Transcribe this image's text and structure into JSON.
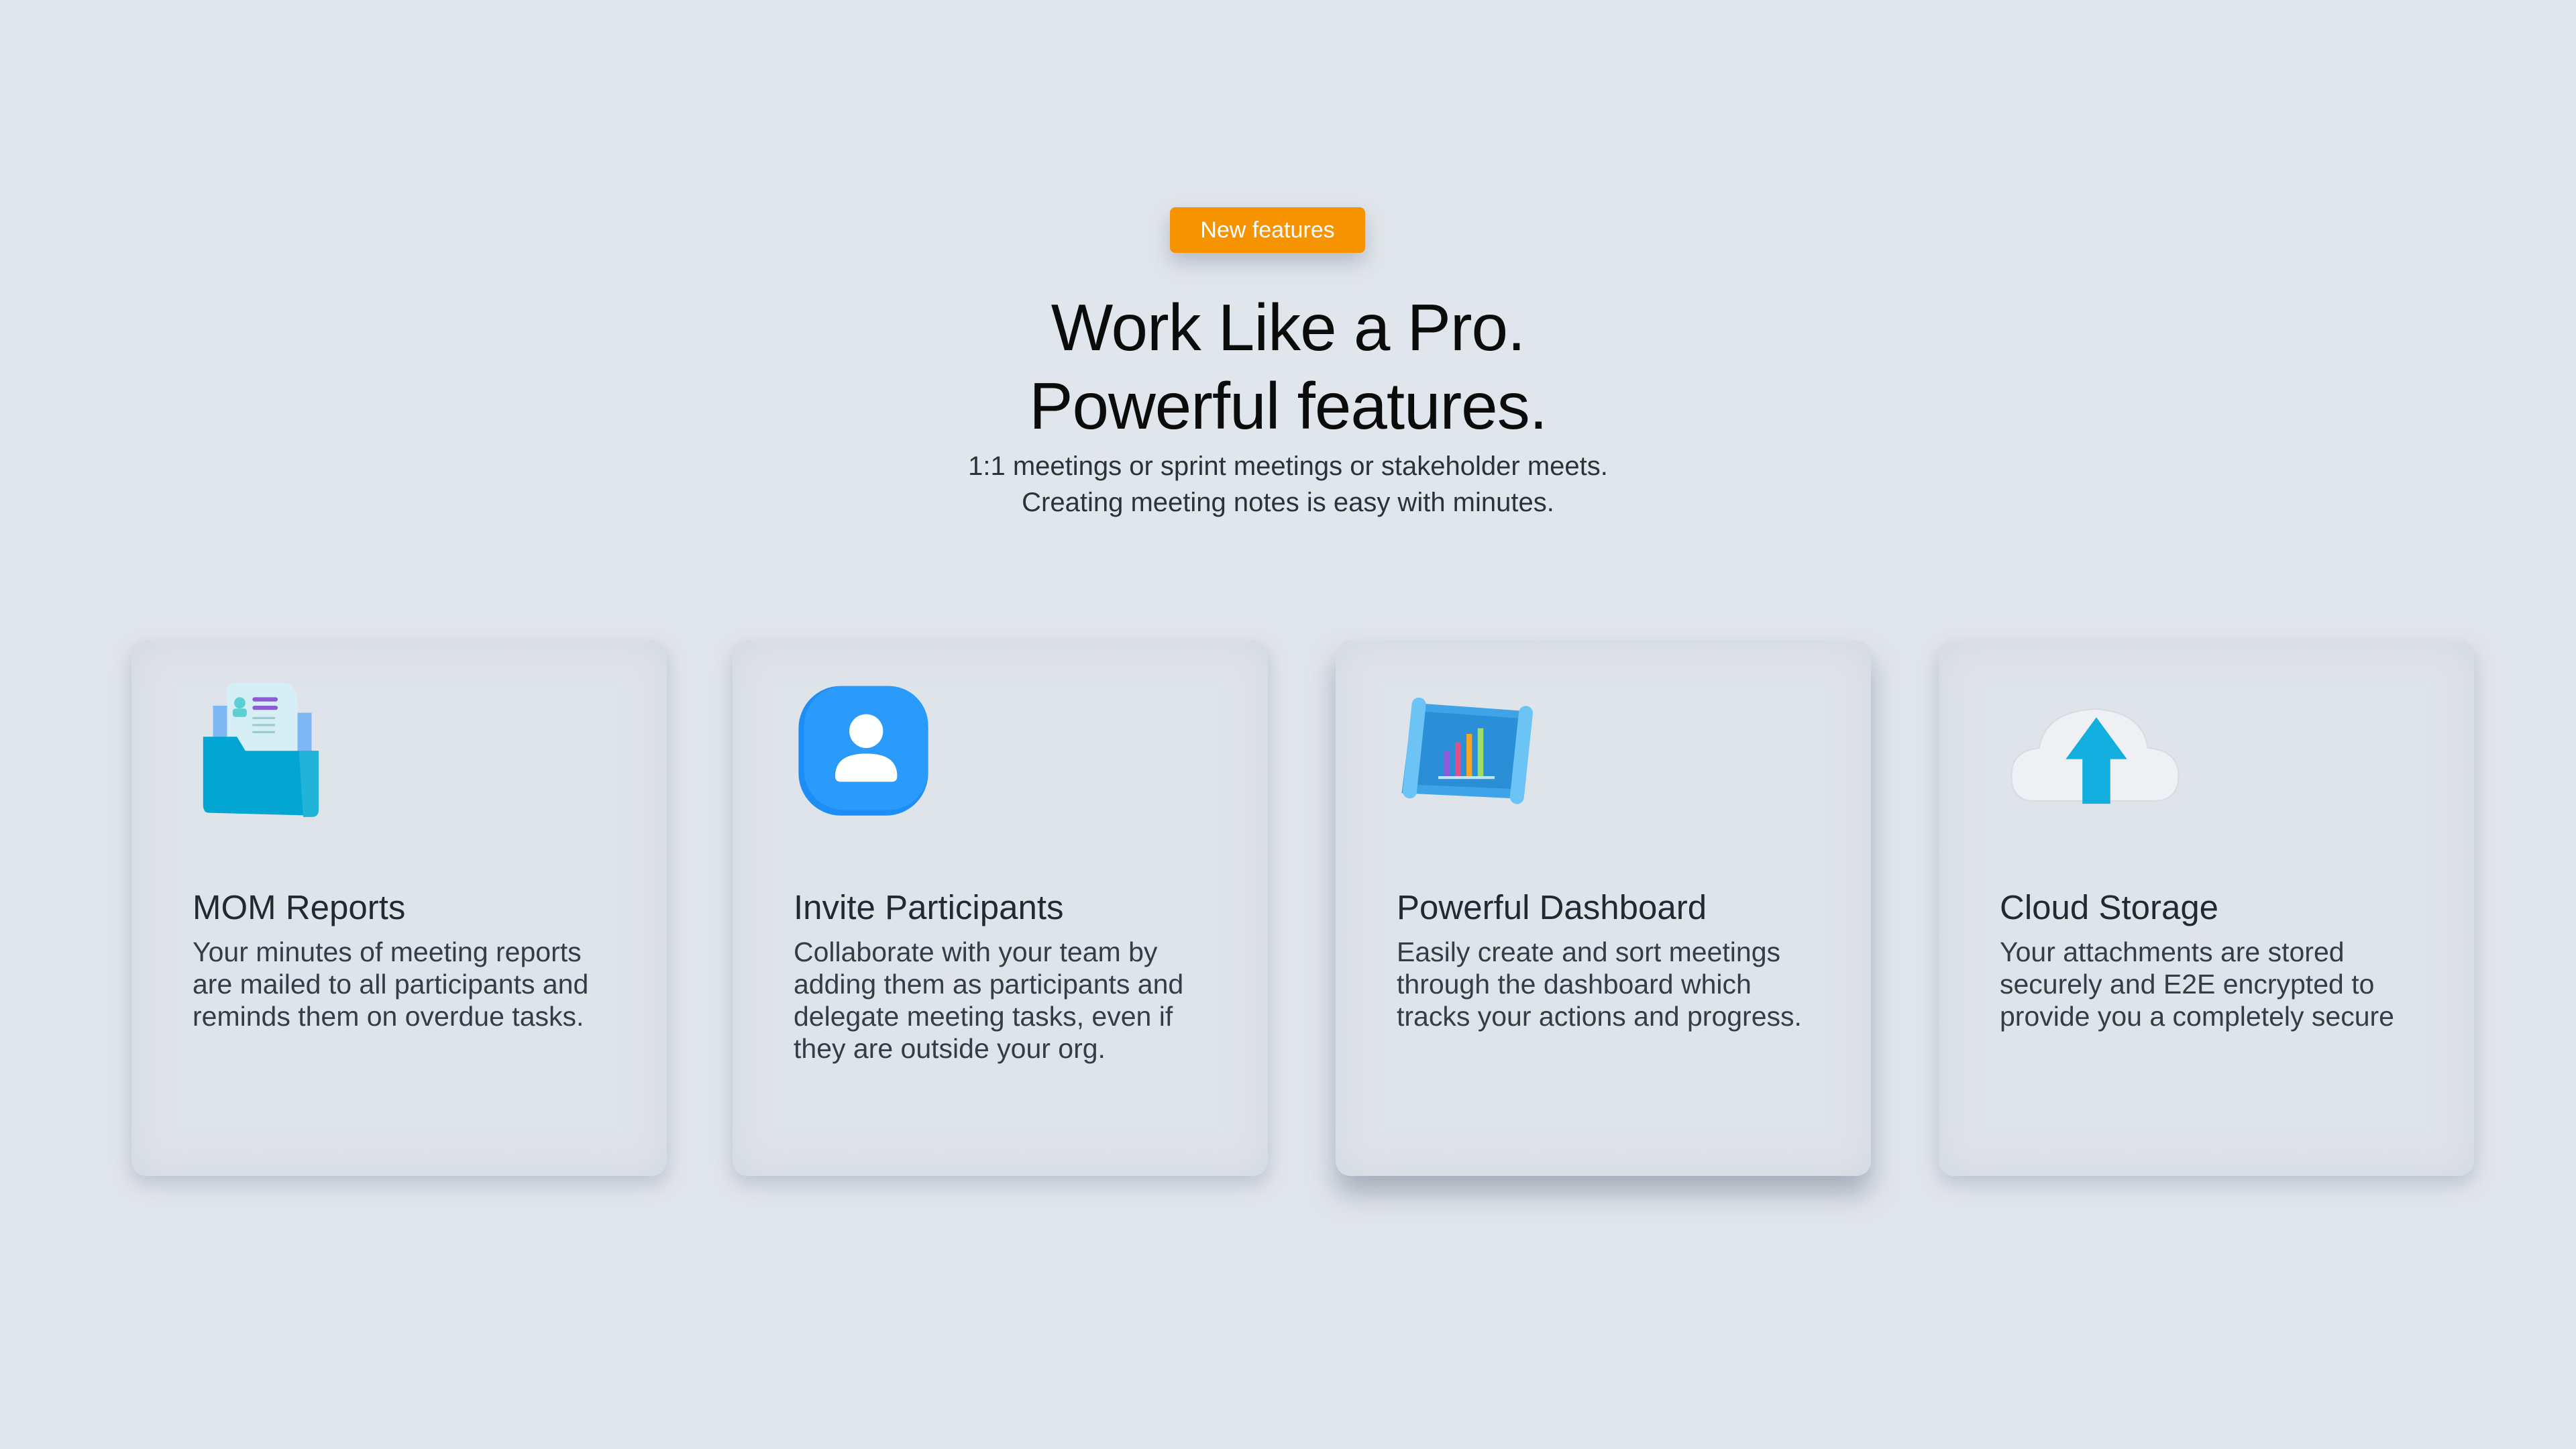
{
  "badge": {
    "label": "New features",
    "color": "#f59300"
  },
  "hero": {
    "title_line1": "Work Like a Pro.",
    "title_line2": "Powerful features.",
    "subtitle_line1": "1:1 meetings or sprint meetings or stakeholder meets.",
    "subtitle_line2": "Creating meeting notes is easy with minutes."
  },
  "cards": [
    {
      "icon": "folder-report-icon",
      "title": "MOM Reports",
      "description": "Your minutes of meeting reports are mailed to all participants and reminds them on overdue tasks."
    },
    {
      "icon": "user-icon",
      "title": "Invite Participants",
      "description": "Collaborate with your team by adding them as participants and delegate meeting tasks, even if they are outside your org."
    },
    {
      "icon": "dashboard-chart-icon",
      "title": "Powerful Dashboard",
      "description": "Easily create and sort meetings through the dashboard which tracks your actions and progress."
    },
    {
      "icon": "cloud-upload-icon",
      "title": "Cloud Storage",
      "description": "Your attachments are stored securely and E2E encrypted to provide you a completely secure"
    }
  ]
}
